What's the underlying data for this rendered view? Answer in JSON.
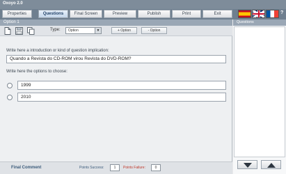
{
  "app": {
    "title": "Oxoyo 2.0"
  },
  "menu": {
    "items": [
      {
        "label": "Properties"
      },
      {
        "label": "Questions"
      },
      {
        "label": "Final Screen"
      },
      {
        "label": "Preview"
      },
      {
        "label": "Publish"
      },
      {
        "label": "Print"
      },
      {
        "label": "Exit"
      }
    ],
    "active": "Questions",
    "help_label": "?"
  },
  "languages": [
    "spanish-flag-icon",
    "uk-flag-icon",
    "french-flag-icon"
  ],
  "editor": {
    "header": "Option 1",
    "toolbar": {
      "icons": [
        "new-document-icon",
        "save-icon",
        "copy-icon"
      ],
      "type_label": "Type:",
      "type_value": "Option",
      "add_option_label": "+ Option",
      "remove_option_label": "- Option"
    },
    "intro_label": "Write here a introduction or kind of question implication:",
    "question_value": "Quando a Revista do CD-ROM virou Revista do DVD-ROM?",
    "choose_label": "Write here the options to choose:",
    "options": [
      {
        "value": "1999",
        "selected": false
      },
      {
        "value": "2010",
        "selected": false
      }
    ]
  },
  "footer": {
    "final_comment_label": "Final Comment",
    "points_success_label": "Points Success:",
    "points_success_value": "1",
    "points_failure_label": "Points Failure:",
    "points_failure_value": "0"
  },
  "sidebar": {
    "header": "Questions",
    "nav": [
      "down-arrow-icon",
      "up-arrow-icon"
    ]
  },
  "colors": {
    "titlebar": "#7e8c9a",
    "menubar": "#6f7f8f",
    "panel_header": "#9aa7b5",
    "failure_text": "#c0392b"
  }
}
